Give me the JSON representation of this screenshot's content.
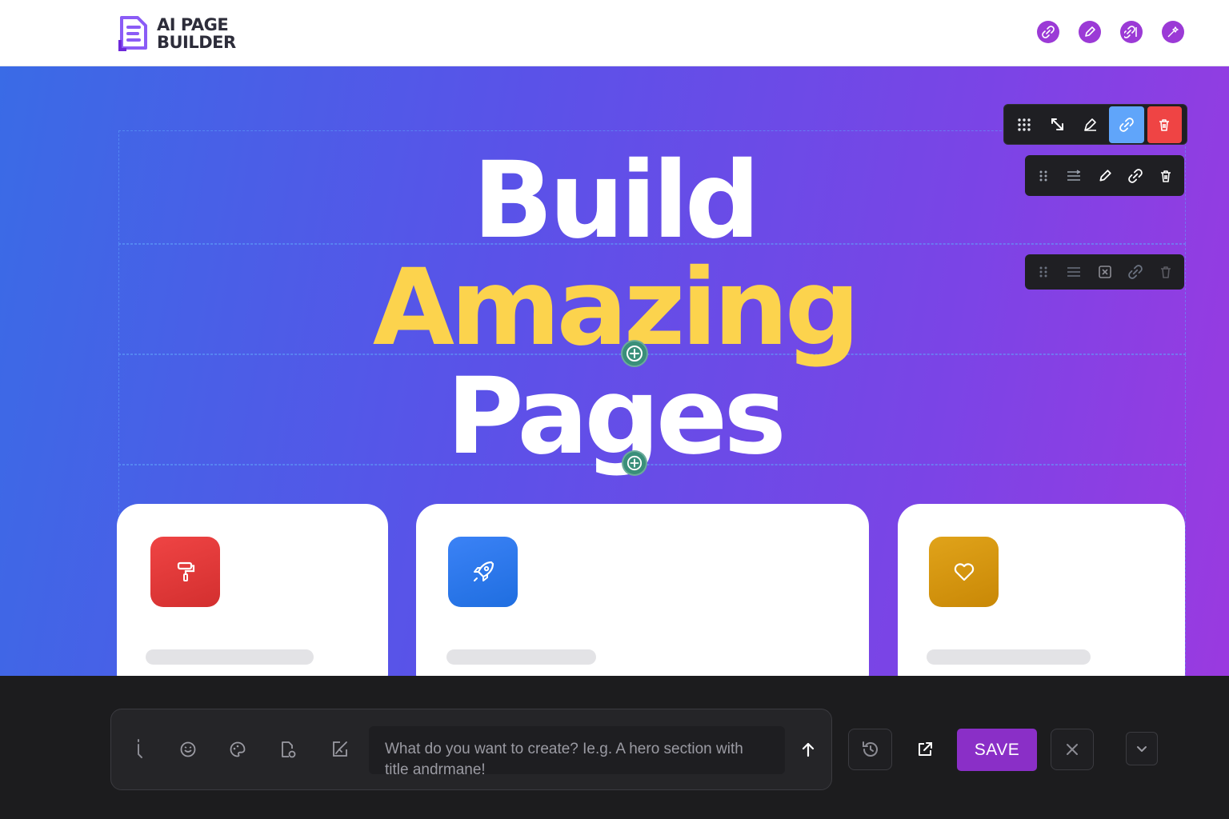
{
  "header": {
    "logo_line1": "AI PAGE",
    "logo_line2": "BUILDER",
    "icons": [
      "link-icon",
      "pencil-icon",
      "link-edit-icon",
      "magic-wand-icon"
    ]
  },
  "hero": {
    "line1": "Build",
    "line2": "Amazing",
    "line3": "Pages",
    "accent_color": "#fcd34d"
  },
  "toolbars": {
    "primary": [
      "drag-grid-icon",
      "resize-icon",
      "style-icon",
      "link-icon",
      "trash-icon"
    ],
    "secondary": [
      "drag-dots-icon",
      "align-icon",
      "pencil-icon",
      "link-icon",
      "trash-icon"
    ],
    "tertiary": [
      "drag-dots-icon",
      "align-icon",
      "close-box-icon",
      "link-icon",
      "trash-icon"
    ]
  },
  "cards": [
    {
      "icon": "paint-roller-icon",
      "color": "#e53935"
    },
    {
      "icon": "rocket-icon",
      "color": "#2f7be8"
    },
    {
      "icon": "heart-icon",
      "color": "#d69a0e"
    }
  ],
  "composer": {
    "placeholder": "What do you want to create? Ie.g. A hero section with title andrmane!",
    "tool_icons": [
      "cursor-icon",
      "emoji-icon",
      "palette-icon",
      "file-add-icon",
      "image-edit-icon"
    ],
    "save_label": "SAVE"
  },
  "colors": {
    "brand": "#8a2fc7",
    "danger": "#ef4444",
    "highlight": "#60a5fa"
  }
}
